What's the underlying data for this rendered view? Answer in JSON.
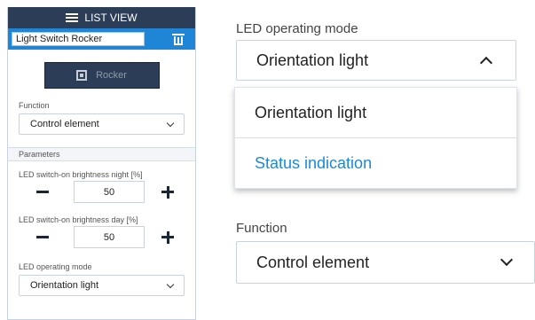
{
  "panel": {
    "header_title": "LIST VIEW",
    "device_name": "Light Switch Rocker",
    "rocker_label": "Rocker",
    "function_label": "Function",
    "function_value": "Control element",
    "parameters_label": "Parameters",
    "night_label": "LED switch-on brightness night [%]",
    "night_value": "50",
    "day_label": "LED switch-on brightness day [%]",
    "day_value": "50",
    "led_mode_label": "LED operating mode",
    "led_mode_value": "Orientation light"
  },
  "zoom": {
    "led_mode_label": "LED operating mode",
    "led_mode_value": "Orientation light",
    "options": [
      "Orientation light",
      "Status indication"
    ],
    "function_label": "Function",
    "function_value": "Control element"
  },
  "colors": {
    "header_bg": "#2c3e57",
    "accent": "#1f85d6",
    "option_highlight": "#1a8ad6"
  }
}
